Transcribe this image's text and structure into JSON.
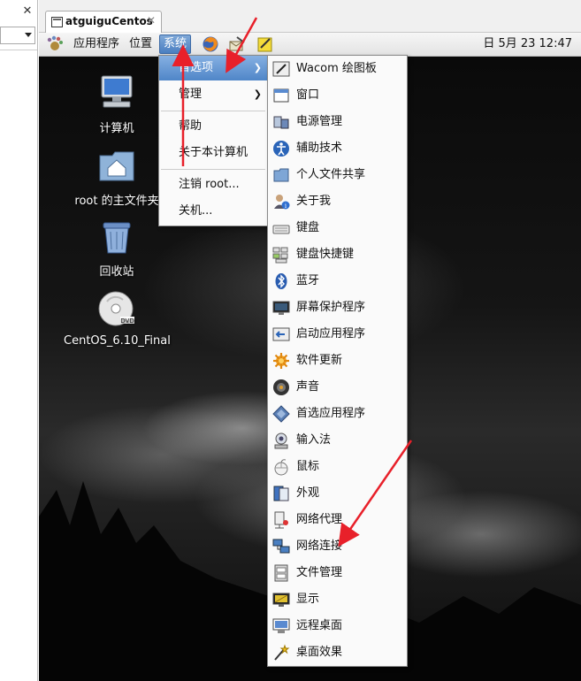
{
  "host": {
    "close_glyph": "✕"
  },
  "vm_tab": {
    "label": "atguiguCentos",
    "close_glyph": "✕"
  },
  "panel": {
    "menus": {
      "apps": "应用程序",
      "places": "位置",
      "system": "系统"
    },
    "clock": "日 5月 23 12:47",
    "launchers": [
      "firefox-icon",
      "mail-send-icon",
      "notes-icon"
    ]
  },
  "desktop": {
    "icons": [
      {
        "name": "computer-icon",
        "label": "计算机"
      },
      {
        "name": "home-folder-icon",
        "label": "root 的主文件夹"
      },
      {
        "name": "trash-icon",
        "label": "回收站"
      },
      {
        "name": "dvd-icon",
        "label": "CentOS_6.10_Final"
      }
    ]
  },
  "system_menu": {
    "items": [
      {
        "label": "首选项",
        "submenu": true,
        "highlighted": true
      },
      {
        "label": "管理",
        "submenu": true,
        "highlighted": false
      },
      {
        "label": "帮助",
        "submenu": false,
        "highlighted": false
      },
      {
        "label": "关于本计算机",
        "submenu": false,
        "highlighted": false
      },
      {
        "label": "注销 root...",
        "submenu": false,
        "highlighted": false
      },
      {
        "label": "关机...",
        "submenu": false,
        "highlighted": false
      }
    ],
    "arrow_glyph": "❯"
  },
  "preferences_menu": {
    "items": [
      {
        "label": "Wacom 绘图板",
        "icon": "wacom-tablet-icon"
      },
      {
        "label": "窗口",
        "icon": "window-icon"
      },
      {
        "label": "电源管理",
        "icon": "power-management-icon"
      },
      {
        "label": "辅助技术",
        "icon": "accessibility-icon"
      },
      {
        "label": "个人文件共享",
        "icon": "file-sharing-icon"
      },
      {
        "label": "关于我",
        "icon": "about-me-icon"
      },
      {
        "label": "键盘",
        "icon": "keyboard-icon"
      },
      {
        "label": "键盘快捷键",
        "icon": "keyboard-shortcuts-icon"
      },
      {
        "label": "蓝牙",
        "icon": "bluetooth-icon"
      },
      {
        "label": "屏幕保护程序",
        "icon": "screensaver-icon"
      },
      {
        "label": "启动应用程序",
        "icon": "startup-apps-icon"
      },
      {
        "label": "软件更新",
        "icon": "software-update-icon"
      },
      {
        "label": "声音",
        "icon": "sound-icon"
      },
      {
        "label": "首选应用程序",
        "icon": "preferred-apps-icon"
      },
      {
        "label": "输入法",
        "icon": "input-method-icon"
      },
      {
        "label": "鼠标",
        "icon": "mouse-icon"
      },
      {
        "label": "外观",
        "icon": "appearance-icon"
      },
      {
        "label": "网络代理",
        "icon": "network-proxy-icon"
      },
      {
        "label": "网络连接",
        "icon": "network-connections-icon"
      },
      {
        "label": "文件管理",
        "icon": "file-management-icon"
      },
      {
        "label": "显示",
        "icon": "display-icon"
      },
      {
        "label": "远程桌面",
        "icon": "remote-desktop-icon"
      },
      {
        "label": "桌面效果",
        "icon": "desktop-effects-icon"
      }
    ]
  },
  "colors": {
    "annotation_arrow": "#e8202a",
    "menu_highlight": "#4f86c8"
  }
}
